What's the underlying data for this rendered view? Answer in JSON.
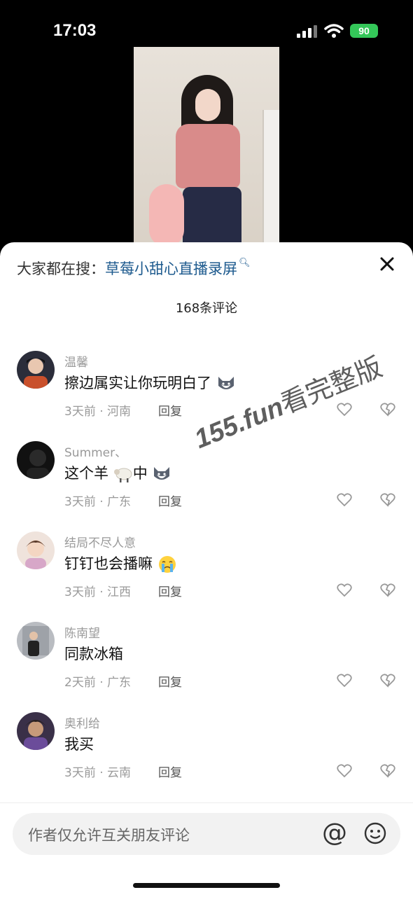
{
  "status_bar": {
    "time": "17:03",
    "battery": "90"
  },
  "search": {
    "prefix": "大家都在搜：",
    "keyword": "草莓小甜心直播录屏"
  },
  "comments_count": "168条评论",
  "comments": [
    {
      "name": "温馨",
      "text": "擦边属实让你玩明白了",
      "meta": "3天前 · 河南",
      "reply": "回复"
    },
    {
      "name": "Summer、",
      "text_a": "这个羊",
      "text_b": "中",
      "meta": "3天前 · 广东",
      "reply": "回复"
    },
    {
      "name": "结局不尽人意",
      "text": "钉钉也会播嘛",
      "meta": "3天前 · 江西",
      "reply": "回复"
    },
    {
      "name": "陈南望",
      "text": "同款冰箱",
      "meta": "2天前 · 广东",
      "reply": "回复"
    },
    {
      "name": "奥利给",
      "text": "我买",
      "meta": "3天前 · 云南",
      "reply": "回复"
    }
  ],
  "input": {
    "placeholder": "作者仅允许互关朋友评论",
    "at_symbol": "@"
  },
  "watermark": {
    "latin": "155.fun",
    "cn": "看完整版"
  },
  "colors": {
    "keyword": "#1d5a8e",
    "battery": "#34c759"
  }
}
